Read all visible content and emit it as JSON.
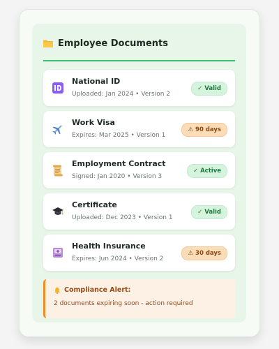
{
  "panel": {
    "title": "Employee Documents",
    "icon": "folder-icon"
  },
  "documents": [
    {
      "name": "National ID",
      "meta": "Uploaded: Jan 2024 • Version 2",
      "badge": "✓ Valid",
      "status": "valid",
      "icon": "id-card-icon"
    },
    {
      "name": "Work Visa",
      "meta": "Expires: Mar 2025 • Version 1",
      "badge": "⚠ 90 days",
      "status": "expiring",
      "icon": "airplane-icon"
    },
    {
      "name": "Employment Contract",
      "meta": "Signed: Jan 2020 • Version 3",
      "badge": "✓ Active",
      "status": "active",
      "icon": "scroll-icon"
    },
    {
      "name": "Certificate",
      "meta": "Uploaded: Dec 2023 • Version 1",
      "badge": "✓ Valid",
      "status": "valid",
      "icon": "graduation-cap-icon"
    },
    {
      "name": "Health Insurance",
      "meta": "Expires: Jun 2024 • Version 2",
      "badge": "⚠ 30 days",
      "status": "expiring",
      "icon": "insurance-card-icon"
    }
  ],
  "alert": {
    "title": "Compliance Alert:",
    "message": "2 documents expiring soon - action required",
    "icon": "bell-icon"
  },
  "colors": {
    "accent": "#38c16c",
    "valid_badge": "#d6f3de",
    "warning_badge": "#fbdcb8",
    "alert_border": "#f08a24"
  }
}
